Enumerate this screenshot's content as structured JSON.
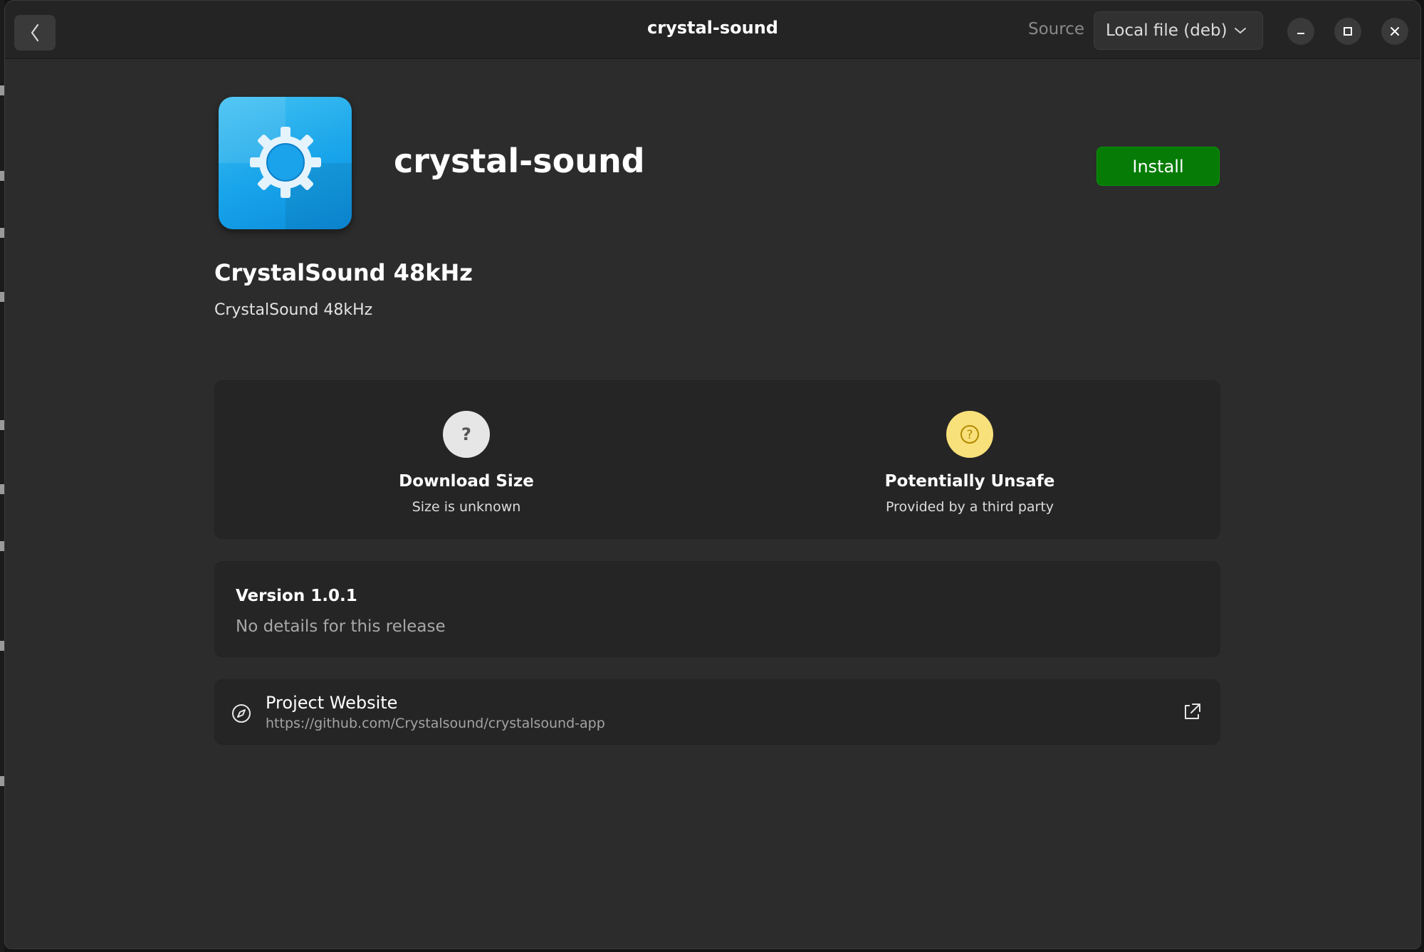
{
  "window": {
    "title": "crystal-sound"
  },
  "header": {
    "back_icon": "chevron-left-icon",
    "source_label": "Source",
    "source_selected": "Local file (deb)",
    "window_controls": [
      "minimize-icon",
      "maximize-icon",
      "close-icon"
    ]
  },
  "app": {
    "icon": "gear-icon",
    "name": "crystal-sound",
    "install_label": "Install",
    "summary": "CrystalSound 48kHz",
    "description": "CrystalSound 48kHz"
  },
  "info": {
    "download": {
      "icon": "question-icon",
      "title": "Download Size",
      "subtitle": "Size is unknown"
    },
    "safety": {
      "icon": "warning-question-icon",
      "title": "Potentially Unsafe",
      "subtitle": "Provided by a third party"
    }
  },
  "version": {
    "title": "Version 1.0.1",
    "details": "No details for this release"
  },
  "website": {
    "icon": "compass-icon",
    "title": "Project Website",
    "url": "https://github.com/Crystalsound/crystalsound-app",
    "action_icon": "external-link-icon"
  },
  "colors": {
    "accent_install": "#067c06",
    "warning_badge": "#f8e07a",
    "neutral_badge": "#e6e6e6",
    "icon_blue": "#18a4ea"
  }
}
